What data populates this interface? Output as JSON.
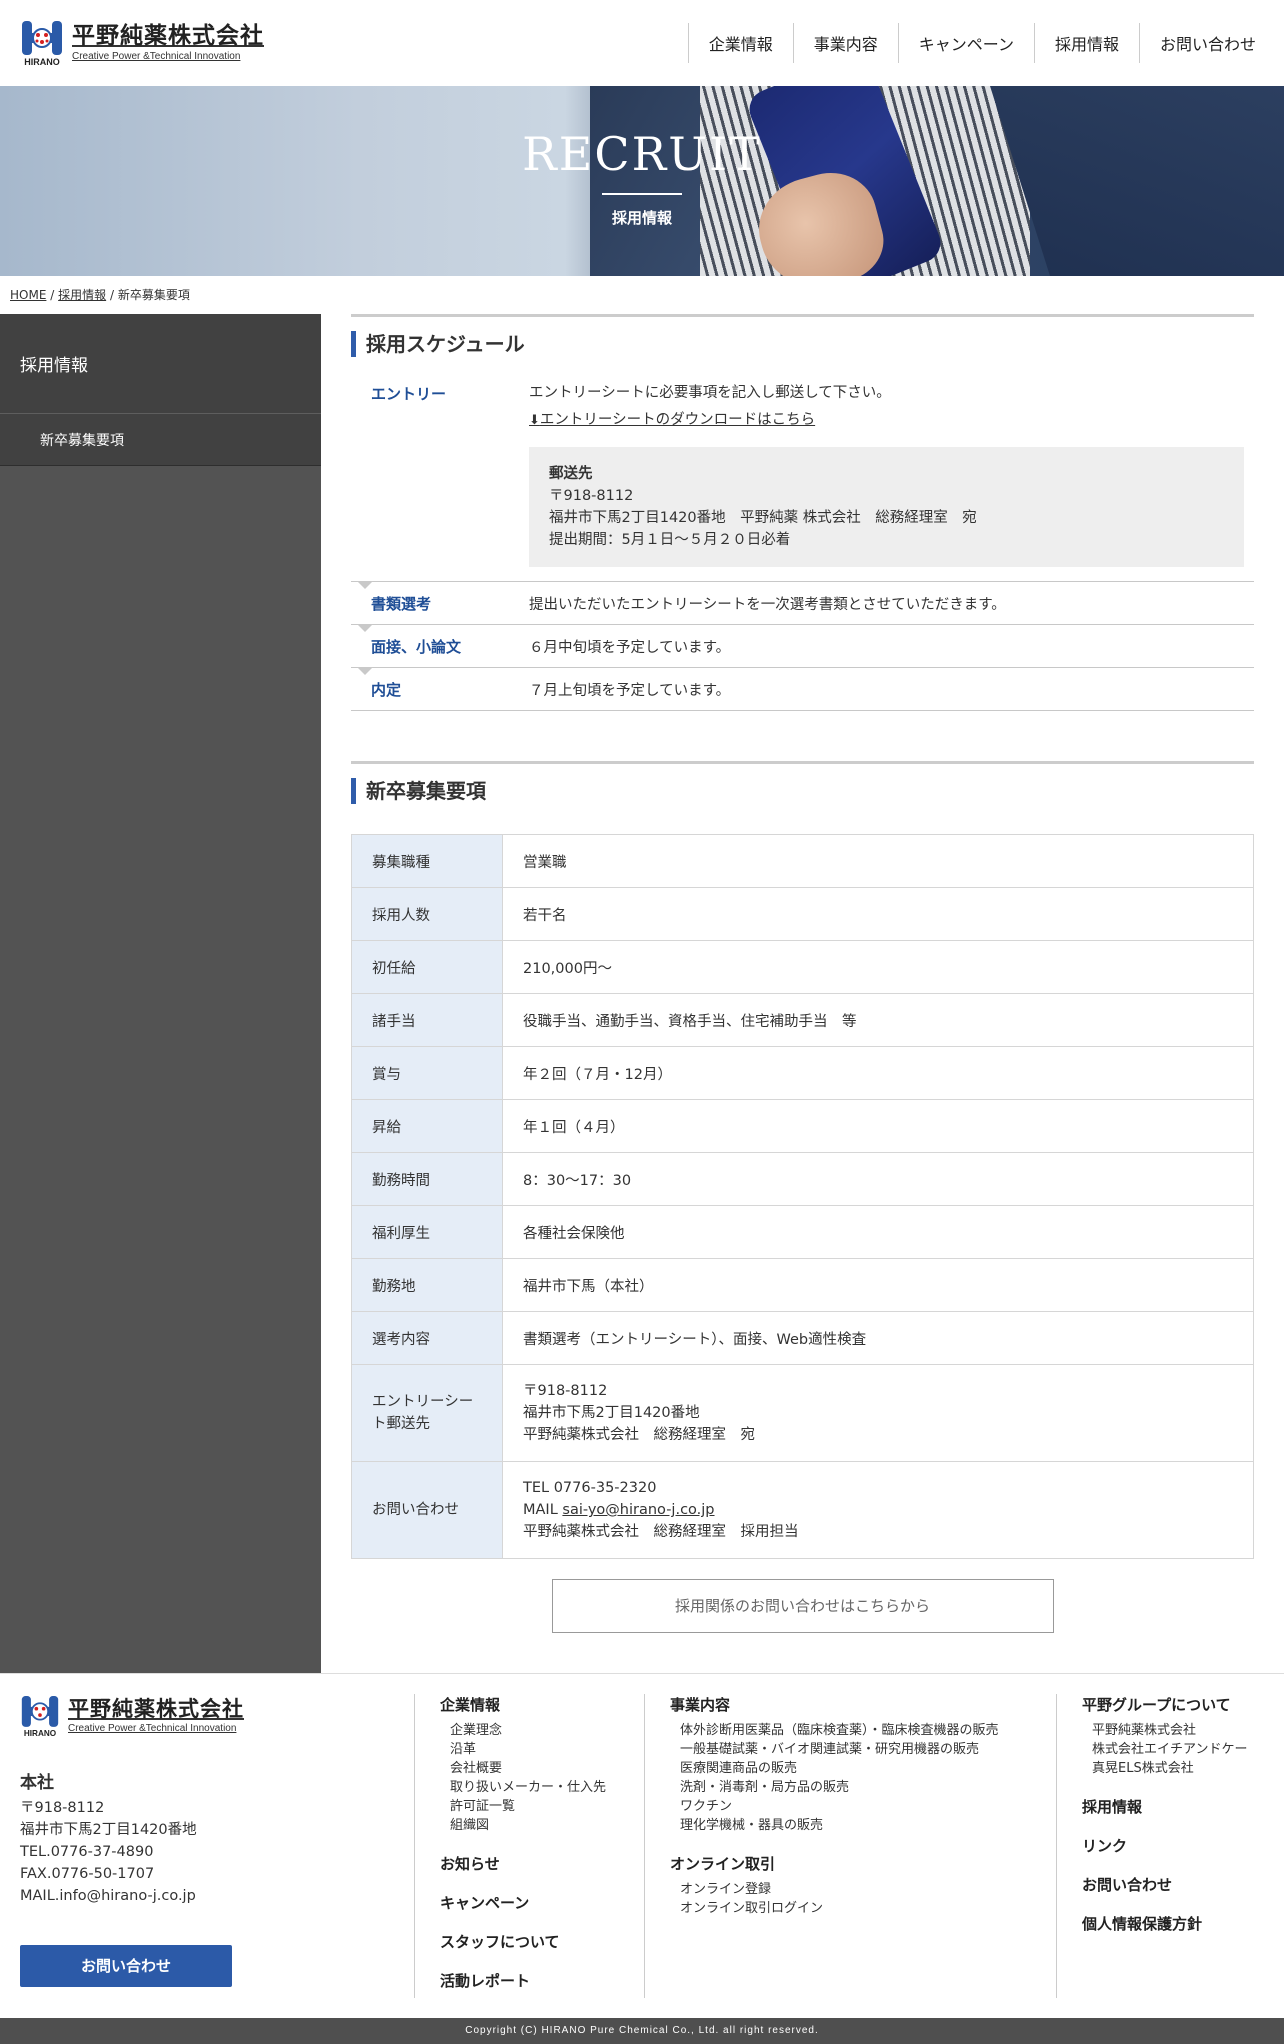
{
  "header": {
    "logo_text": "平野純薬株式会社",
    "logo_sub": "Creative Power &Technical Innovation",
    "logo_brand": "HIRANO",
    "nav": [
      "企業情報",
      "事業内容",
      "キャンペーン",
      "採用情報",
      "お問い合わせ"
    ]
  },
  "hero": {
    "title": "RECRUIT",
    "subtitle": "採用情報"
  },
  "breadcrumb": {
    "home": "HOME",
    "sep": "/",
    "parent": "採用情報",
    "current": "新卒募集要項"
  },
  "sidebar": {
    "heading": "採用情報",
    "items": [
      "新卒募集要項"
    ]
  },
  "schedule": {
    "title": "採用スケジュール",
    "entry": {
      "label": "エントリー",
      "text": "エントリーシートに必要事項を記入し郵送して下さい。",
      "download": "エントリーシートのダウンロードはこちら",
      "box_title": "郵送先",
      "box_lines": [
        "〒918-8112",
        "福井市下馬2丁目1420番地　平野純薬 株式会社　総務経理室　宛",
        "提出期間：5月１日～５月２０日必着"
      ]
    },
    "steps": [
      {
        "label": "書類選考",
        "text": "提出いただいたエントリーシートを一次選考書類とさせていただきます。"
      },
      {
        "label": "面接、小論文",
        "text": "６月中旬頃を予定しています。"
      },
      {
        "label": "内定",
        "text": "７月上旬頃を予定しています。"
      }
    ]
  },
  "requirements": {
    "title": "新卒募集要項",
    "rows": [
      {
        "head": "募集職種",
        "lines": [
          "営業職"
        ]
      },
      {
        "head": "採用人数",
        "lines": [
          "若干名"
        ]
      },
      {
        "head": "初任給",
        "lines": [
          "210,000円～"
        ]
      },
      {
        "head": "諸手当",
        "lines": [
          "役職手当、通勤手当、資格手当、住宅補助手当　等"
        ]
      },
      {
        "head": "賞与",
        "lines": [
          "年２回（７月・12月）"
        ]
      },
      {
        "head": "昇給",
        "lines": [
          "年１回（４月）"
        ]
      },
      {
        "head": "勤務時間",
        "lines": [
          "8：30～17：30"
        ]
      },
      {
        "head": "福利厚生",
        "lines": [
          "各種社会保険他"
        ]
      },
      {
        "head": "勤務地",
        "lines": [
          "福井市下馬（本社）"
        ]
      },
      {
        "head": "選考内容",
        "lines": [
          "書類選考（エントリーシート）、面接、Web適性検査"
        ]
      },
      {
        "head": "エントリーシート郵送先",
        "lines": [
          "〒918-8112",
          "福井市下馬2丁目1420番地",
          "平野純薬株式会社　総務経理室　宛"
        ]
      }
    ],
    "contact_row": {
      "head": "お問い合わせ",
      "tel": "TEL 0776-35-2320",
      "mail_label": "MAIL ",
      "mail": "sai-yo@hirano-j.co.jp",
      "dept": "平野純薬株式会社　総務経理室　採用担当"
    },
    "button": "採用関係のお問い合わせはこちらから"
  },
  "footer": {
    "office_title": "本社",
    "office_lines": [
      "〒918-8112",
      "福井市下馬2丁目1420番地",
      "TEL.0776-37-4890",
      "FAX.0776-50-1707",
      "MAIL.info@hirano-j.co.jp"
    ],
    "contact_button": "お問い合わせ",
    "col2": {
      "heading": "企業情報",
      "items": [
        "企業理念",
        "沿革",
        "会社概要",
        "取り扱いメーカー・仕入先",
        "許可証一覧",
        "組織図"
      ],
      "links": [
        "お知らせ",
        "キャンペーン",
        "スタッフについて",
        "活動レポート"
      ]
    },
    "col3": {
      "heading": "事業内容",
      "items": [
        "体外診断用医薬品（臨床検査薬）・臨床検査機器の販売",
        "一般基礎試薬・バイオ関連試薬・研究用機器の販売",
        "医療関連商品の販売",
        "洗剤・消毒剤・局方品の販売",
        "ワクチン",
        "理化学機械・器具の販売"
      ],
      "heading2": "オンライン取引",
      "items2": [
        "オンライン登録",
        "オンライン取引ログイン"
      ]
    },
    "col4": {
      "heading": "平野グループについて",
      "items": [
        "平野純薬株式会社",
        "株式会社エイチアンドケー",
        "真晃ELS株式会社"
      ],
      "links": [
        "採用情報",
        "リンク",
        "お問い合わせ",
        "個人情報保護方針"
      ]
    },
    "copyright": "Copyright (C) HIRANO Pure Chemical Co., Ltd. all right reserved."
  },
  "colors": {
    "accent": "#2f5caa",
    "sidebar": "#535353",
    "table_head": "#e5edf7"
  }
}
